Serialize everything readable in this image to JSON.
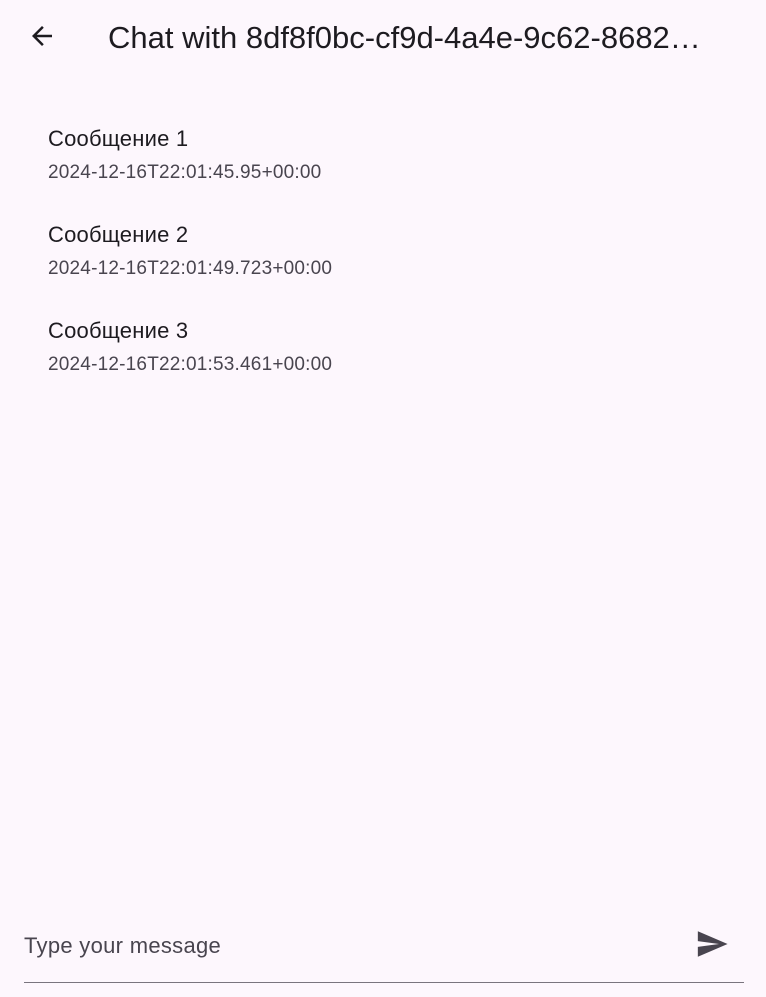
{
  "app_bar": {
    "back_icon": "arrow-back-icon",
    "title": "Chat with 8df8f0bc-cf9d-4a4e-9c62-8682…"
  },
  "messages": [
    {
      "text": "Сообщение 1",
      "timestamp": "2024-12-16T22:01:45.95+00:00"
    },
    {
      "text": "Сообщение 2",
      "timestamp": "2024-12-16T22:01:49.723+00:00"
    },
    {
      "text": "Сообщение 3",
      "timestamp": "2024-12-16T22:01:53.461+00:00"
    }
  ],
  "composer": {
    "placeholder": "Type your message",
    "value": "",
    "send_icon": "send-icon"
  },
  "colors": {
    "background": "#fdf7fd",
    "text_primary": "#1d1b20",
    "text_secondary": "#49454f",
    "icon": "#49454f",
    "underline": "#79747e"
  }
}
